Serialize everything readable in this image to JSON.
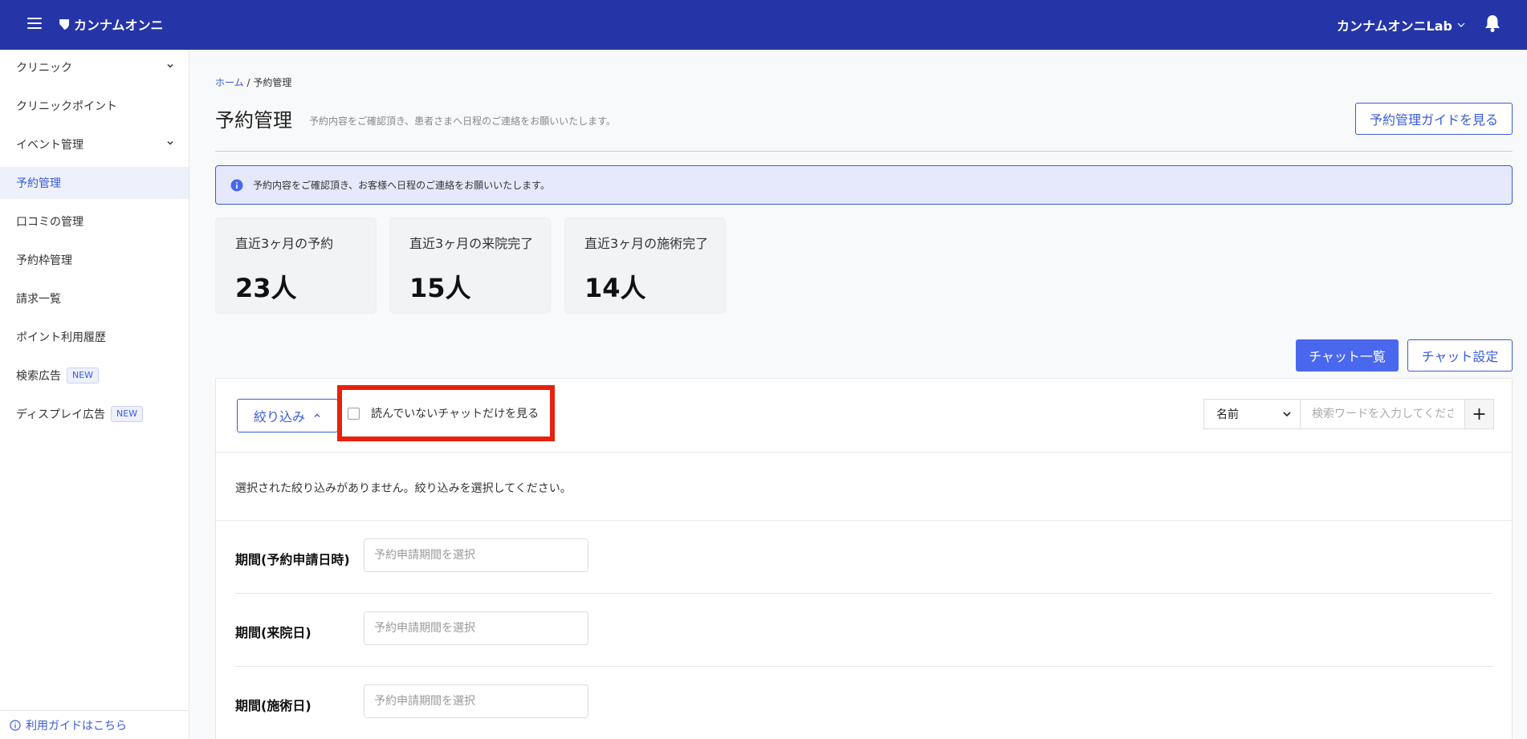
{
  "header": {
    "brand": "カンナムオンニ",
    "user_name": "カンナムオンニLab"
  },
  "sidebar": {
    "items": [
      {
        "label": "クリニック"
      },
      {
        "label": "クリニックポイント"
      },
      {
        "label": "イベント管理"
      },
      {
        "label": "予約管理"
      },
      {
        "label": "口コミの管理"
      },
      {
        "label": "予約枠管理"
      },
      {
        "label": "請求一覧"
      },
      {
        "label": "ポイント利用履歴"
      },
      {
        "label": "検索広告",
        "badge": "NEW"
      },
      {
        "label": "ディスプレイ広告",
        "badge": "NEW"
      }
    ],
    "footer_link": "利用ガイドはこちら"
  },
  "breadcrumb": {
    "home": "ホーム",
    "separator": "/",
    "current": "予約管理"
  },
  "page": {
    "title": "予約管理",
    "description": "予約内容をご確認頂き、患者さまへ日程のご連絡をお願いいたします。",
    "guide_button": "予約管理ガイドを見る"
  },
  "notice": {
    "text": "予約内容をご確認頂き、お客様へ日程のご連絡をお願いいたします。"
  },
  "stats": [
    {
      "label": "直近3ヶ月の予約",
      "value": "23人"
    },
    {
      "label": "直近3ヶ月の来院完了",
      "value": "15人"
    },
    {
      "label": "直近3ヶ月の施術完了",
      "value": "14人"
    }
  ],
  "actions": {
    "chat_list": "チャット一覧",
    "chat_settings": "チャット設定"
  },
  "filter": {
    "button_label": "絞り込み",
    "unread_only_label": "読んでいないチャットだけを見る",
    "search_field_selected": "名前",
    "search_placeholder": "検索ワードを入力してください",
    "add_button": "+",
    "empty_message": "選択された絞り込みがありません。絞り込みを選択してください。"
  },
  "periods": [
    {
      "label": "期間(予約申請日時)",
      "placeholder": "予約申請期間を選択"
    },
    {
      "label": "期間(来院日)",
      "placeholder": "予約申請期間を選択"
    },
    {
      "label": "期間(施術日)",
      "placeholder": "予約申請期間を選択"
    }
  ],
  "colors": {
    "header_bg": "#2535a7",
    "accent": "#3a5ad9",
    "primary_button": "#4a68ee",
    "highlight": "#e8210d"
  }
}
